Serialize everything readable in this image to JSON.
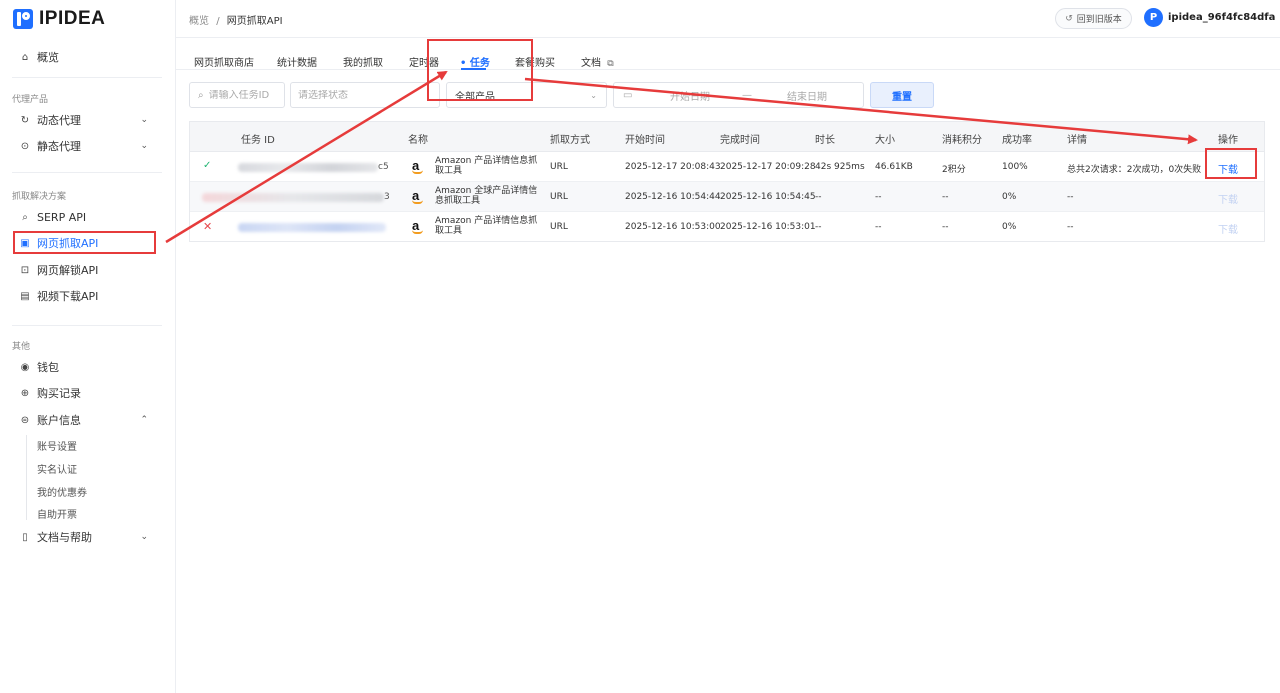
{
  "brand": {
    "name": "IPIDEA"
  },
  "sidebar": {
    "overview": "概览",
    "group_proxy": "代理产品",
    "dynamic_proxy": "动态代理",
    "static_proxy": "静态代理",
    "group_scrape": "抓取解决方案",
    "serp_api": "SERP API",
    "web_scrape_api": "网页抓取API",
    "web_unlock_api": "网页解锁API",
    "video_download_api": "视频下载API",
    "group_other": "其他",
    "wallet": "钱包",
    "purchase_records": "购买记录",
    "account_info": "账户信息",
    "account_settings": "账号设置",
    "real_name": "实名认证",
    "coupons": "我的优惠券",
    "self_invoice": "自助开票",
    "docs_help": "文档与帮助"
  },
  "header": {
    "breadcrumb_root": "概览",
    "breadcrumb_sep": "/",
    "breadcrumb_current": "网页抓取API",
    "old_version": "回到旧版本",
    "username": "ipidea_96f4fc84dfa"
  },
  "tabs": {
    "store": "网页抓取商店",
    "stats": "统计数据",
    "my_scrape": "我的抓取",
    "scheduler": "定时器",
    "tasks": "• 任务",
    "packages": "套餐购买",
    "docs": "文档"
  },
  "filters": {
    "task_id_placeholder": "请输入任务ID",
    "status_placeholder": "请选择状态",
    "product_value": "全部产品",
    "start_date_placeholder": "开始日期",
    "date_sep": "—",
    "end_date_placeholder": "结束日期",
    "reset": "重置"
  },
  "table": {
    "columns": {
      "task_id": "任务 ID",
      "name": "名称",
      "method": "抓取方式",
      "start_time": "开始时间",
      "end_time": "完成时间",
      "duration": "时长",
      "size": "大小",
      "credits": "消耗积分",
      "success_rate": "成功率",
      "details": "详情",
      "action": "操作"
    },
    "rows": [
      {
        "status": "success",
        "id_suffix": "c5",
        "name": "Amazon 产品详情信息抓取工具",
        "method": "URL",
        "start_time": "2025-12-17 20:08:43",
        "end_time": "2025-12-17 20:09:28",
        "duration": "42s 925ms",
        "size": "46.61KB",
        "credits": "2积分",
        "success_rate": "100%",
        "details": "总共2次请求：2次成功，0次失败",
        "action": "下载"
      },
      {
        "status": "none",
        "id_suffix": "3",
        "name": "Amazon 全球产品详情信息抓取工具",
        "method": "URL",
        "start_time": "2025-12-16 10:54:44",
        "end_time": "2025-12-16 10:54:45",
        "duration": "--",
        "size": "--",
        "credits": "--",
        "success_rate": "0%",
        "details": "--",
        "action": "下载"
      },
      {
        "status": "failed",
        "id_suffix": "",
        "name": "Amazon 产品详情信息抓取工具",
        "method": "URL",
        "start_time": "2025-12-16 10:53:00",
        "end_time": "2025-12-16 10:53:01",
        "duration": "--",
        "size": "--",
        "credits": "--",
        "success_rate": "0%",
        "details": "--",
        "action": "下载"
      }
    ]
  },
  "icons": {
    "status_success": "✓",
    "status_failed": "✕"
  },
  "colors": {
    "accent": "#1f6fff",
    "annotation": "#e63b3b",
    "success": "#22b573",
    "danger": "#e5484d"
  }
}
